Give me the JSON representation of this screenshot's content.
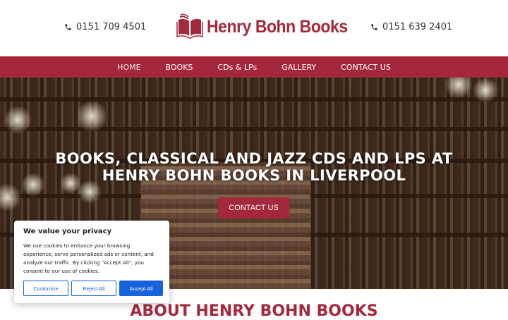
{
  "header": {
    "phone_left": "0151 709 4501",
    "phone_right": "0151 639 2401",
    "logo_text": "Henry Bohn Books"
  },
  "nav": {
    "items": [
      {
        "label": "HOME",
        "active": true
      },
      {
        "label": "BOOKS",
        "active": false
      },
      {
        "label": "CDs & LPs",
        "active": false
      },
      {
        "label": "GALLERY",
        "active": false
      },
      {
        "label": "CONTACT US",
        "active": false
      }
    ]
  },
  "hero": {
    "title": "BOOKS, CLASSICAL AND JAZZ CDS AND LPS AT HENRY BOHN BOOKS IN LIVERPOOL",
    "button_label": "CONTACT US"
  },
  "about": {
    "title": "ABOUT HENRY BOHN BOOKS"
  },
  "cookie_banner": {
    "title": "We value your privacy",
    "body": "We use cookies to enhance your browsing experience, serve personalized ads or content, and analyze our traffic. By clicking \"Accept All\", you consent to our use of cookies.",
    "customize_label": "Customize",
    "reject_label": "Reject All",
    "accept_label": "Accept All"
  },
  "colors": {
    "brand": "#a4283c",
    "cookie_accent": "#1863dc"
  },
  "icons": {
    "phone": "phone-icon",
    "logo": "open-book-icon"
  }
}
